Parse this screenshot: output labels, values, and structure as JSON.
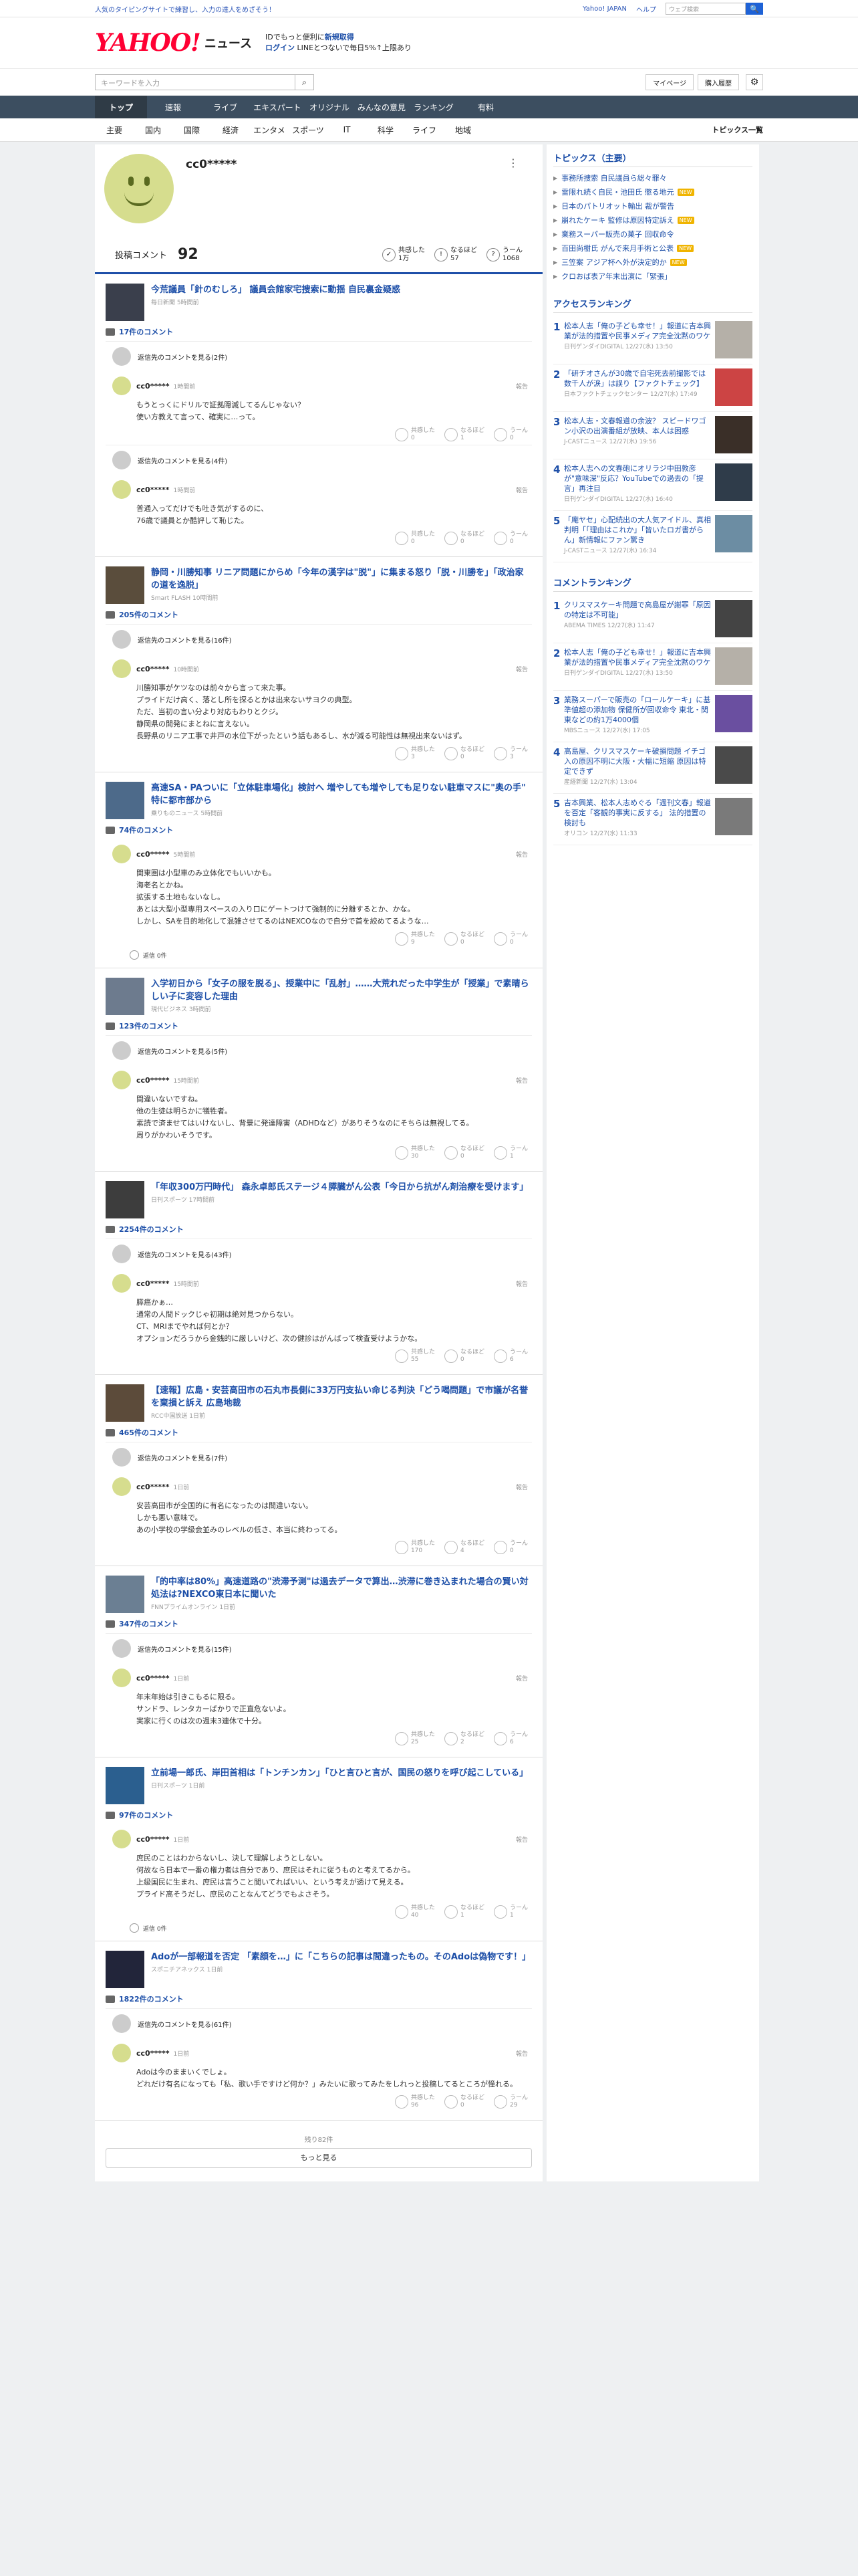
{
  "topbar": {
    "promo": "人気のタイピングサイトで練習し、入力の達人をめざそう！",
    "links": [
      "Yahoo! JAPAN",
      "ヘルプ"
    ],
    "search_placeholder": "ウェブ検索",
    "search_button": "🔍"
  },
  "header": {
    "logo": "YAHOO!",
    "logo_sub": "ニュース",
    "login_line1_a": "IDでもっと便利に",
    "login_line1_b": "新規取得",
    "login_line2": "ログイン",
    "login_line3": "LINEとつないで毎日5%↑上限あり"
  },
  "searchbar": {
    "placeholder": "キーワードを入力",
    "mypage": "マイページ",
    "subscribe": "購入履歴"
  },
  "nav": {
    "main": [
      "トップ",
      "速報",
      "ライブ",
      "エキスパート",
      "オリジナル",
      "みんなの意見",
      "ランキング",
      "有料"
    ],
    "active": "トップ",
    "sub": [
      "主要",
      "国内",
      "国際",
      "経済",
      "エンタメ",
      "スポーツ",
      "IT",
      "科学",
      "ライフ",
      "地域"
    ],
    "topics_link": "トピックス一覧"
  },
  "profile": {
    "name": "cc0*****",
    "comment_label": "投稿コメント",
    "comment_count": "92",
    "stats": [
      {
        "label": "共感した",
        "value": "1万"
      },
      {
        "label": "なるほど",
        "value": "57"
      },
      {
        "label": "うーん",
        "value": "1068"
      }
    ]
  },
  "reactions_labels": {
    "agree": "共感した",
    "naruhodo": "なるほど",
    "un": "うーん"
  },
  "articles": [
    {
      "title": "今荒議員「針のむしろ」 議員会館家宅捜索に動揺 自民裏金疑惑",
      "source": "毎日新聞 5時間前",
      "count": "17件のコメント",
      "thumb": "#3a3f4c",
      "blocks": [
        {
          "type": "replies",
          "text": "返信先のコメントを見る(2件)"
        },
        {
          "type": "comment",
          "user": "cc0*****",
          "time": "1時間前",
          "report": "報告",
          "body": "もうとっくにドリルで証拠隠滅してるんじゃない？\n使い方教えて言って、確実に…って。",
          "r": [
            "0",
            "1",
            "0"
          ]
        },
        {
          "type": "replies",
          "text": "返信先のコメントを見る(4件)"
        },
        {
          "type": "comment",
          "user": "cc0*****",
          "time": "1時間前",
          "report": "報告",
          "body": "普通入ってだけでも吐き気がするのに、\n76歳で議員とか酷評して恥じた。",
          "r": [
            "0",
            "0",
            "0"
          ]
        }
      ]
    },
    {
      "title": "静岡・川勝知事 リニア問題にからめ「今年の漢字は\"脱\"」に集まる怒り「脱・川勝を」「政治家の道を逸脱」",
      "source": "Smart FLASH 10時間前",
      "count": "205件のコメント",
      "thumb": "#5a4d3c",
      "blocks": [
        {
          "type": "replies",
          "text": "返信先のコメントを見る(16件)"
        },
        {
          "type": "comment",
          "user": "cc0*****",
          "time": "10時間前",
          "report": "報告",
          "body": "川勝知事がケツなのは前々から言って来た事。\nプライドだけ高く、落とし所を探るとかは出来ないサヨクの典型。\nただ、当初の言い分より対応もわりとクジ。\n静岡県の開発にまとねに言えない。\n長野県のリニア工事で井戸の水位下がったという話もあるし、水が減る可能性は無視出来ないはず。",
          "r": [
            "3",
            "0",
            "3"
          ]
        }
      ]
    },
    {
      "title": "高速SA・PAついに「立体駐車場化」検討へ 増やしても増やしても足りない駐車マスに\"奥の手\" 特に都市部から",
      "source": "乗りものニュース 5時間前",
      "count": "74件のコメント",
      "thumb": "#4d6a8a",
      "blocks": [
        {
          "type": "comment",
          "user": "cc0*****",
          "time": "5時間前",
          "report": "報告",
          "body": "関東圏は小型車のみ立体化でもいいかも。\n海老名とかね。\n拡張する土地もないなし。\nあとは大型小型専用スペースの入り口にゲートつけて強制的に分離するとか、かな。\nしかし、SAを目的地化して混雑させてるのはNEXCOなので自分で首を絞めてるような…",
          "r": [
            "9",
            "0",
            "0"
          ]
        },
        {
          "type": "retweet",
          "text": "返信 0件"
        }
      ]
    },
    {
      "title": "入学初日から「女子の服を脱る」、授業中に「乱射」……大荒れだった中学生が「授業」で素晴らしい子に変容した理由",
      "source": "現代ビジネス 3時間前",
      "count": "123件のコメント",
      "thumb": "#6d7b8e",
      "blocks": [
        {
          "type": "replies",
          "text": "返信先のコメントを見る(5件)"
        },
        {
          "type": "comment",
          "user": "cc0*****",
          "time": "15時間前",
          "report": "報告",
          "body": "間違いないですね。\n他の生徒は明らかに犠牲者。\n素読で済ませてはいけないし、背景に発達障害（ADHDなど）がありそうなのにそちらは無視してる。\n周りがかわいそうです。",
          "r": [
            "30",
            "0",
            "1"
          ]
        }
      ]
    },
    {
      "title": "「年収300万円時代」 森永卓郎氏ステージ４膵臓がん公表「今日から抗がん剤治療を受けます」",
      "source": "日刊スポーツ 17時間前",
      "count": "2254件のコメント",
      "thumb": "#3d3d3d",
      "blocks": [
        {
          "type": "replies",
          "text": "返信先のコメントを見る(43件)"
        },
        {
          "type": "comment",
          "user": "cc0*****",
          "time": "15時間前",
          "report": "報告",
          "body": "膵癌かぁ…\n通常の人間ドックじゃ初期は絶対見つからない。\nCT、MRIまでやれば何とか？\nオプションだろうから金銭的に厳しいけど、次の健診はがんばって検査受けようかな。",
          "r": [
            "55",
            "0",
            "6"
          ]
        }
      ]
    },
    {
      "title": "【速報】広島・安芸高田市の石丸市長側に33万円支払い命じる判決「どう喝問題」で市議が名誉を棄損と訴え 広島地裁",
      "source": "RCC中国放送 1日前",
      "count": "465件のコメント",
      "thumb": "#5c4b3a",
      "blocks": [
        {
          "type": "replies",
          "text": "返信先のコメントを見る(7件)"
        },
        {
          "type": "comment",
          "user": "cc0*****",
          "time": "1日前",
          "report": "報告",
          "body": "安芸高田市が全国的に有名になったのは間違いない。\nしかも悪い意味で。\nあの小学校の学級会並みのレベルの低さ、本当に終わってる。",
          "r": [
            "170",
            "4",
            "0"
          ]
        }
      ]
    },
    {
      "title": "「的中率は80%」高速道路の\"渋滞予測\"は過去データで算出…渋滞に巻き込まれた場合の賢い対処法は?NEXCO東日本に聞いた",
      "source": "FNNプライムオンライン 1日前",
      "count": "347件のコメント",
      "thumb": "#6b7f93",
      "blocks": [
        {
          "type": "replies",
          "text": "返信先のコメントを見る(15件)"
        },
        {
          "type": "comment",
          "user": "cc0*****",
          "time": "1日前",
          "report": "報告",
          "body": "年末年始は引きこもるに限る。\nサンドラ、レンタカーばかりで正直危ないよ。\n実家に行くのは次の週末3連休で十分。",
          "r": [
            "25",
            "2",
            "6"
          ]
        }
      ]
    },
    {
      "title": "立前場一郎氏、岸田首相は「トンチンカン」「ひと言ひと言が、国民の怒りを呼び起こしている」",
      "source": "日刊スポーツ 1日前",
      "count": "97件のコメント",
      "thumb": "#2b5f8f",
      "blocks": [
        {
          "type": "comment",
          "user": "cc0*****",
          "time": "1日前",
          "report": "報告",
          "body": "庶民のことはわからないし、決して理解しようとしない。\n何故なら日本で一番の権力者は自分であり、庶民はそれに従うものと考えてるから。\n上級国民に生まれ、庶民は言うこと聞いてればいい、という考えが透けて見える。\nプライド高そうだし、庶民のことなんてどうでもよさそう。",
          "r": [
            "40",
            "1",
            "1"
          ]
        },
        {
          "type": "retweet",
          "text": "返信 0件"
        }
      ]
    },
    {
      "title": "Adoが一部報道を否定 「素顔を…」に「こちらの記事は間違ったもの。そのAdoは偽物です！」",
      "source": "スポニチアネックス 1日前",
      "count": "1822件のコメント",
      "thumb": "#22253a",
      "blocks": [
        {
          "type": "replies",
          "text": "返信先のコメントを見る(61件)"
        },
        {
          "type": "comment",
          "user": "cc0*****",
          "time": "1日前",
          "report": "報告",
          "body": "Adoは今のままいくでしょ。\nどれだけ有名になっても「私、歌い手ですけど何か？」みたいに歌ってみたをしれっと投稿してるところが憧れる。",
          "r": [
            "96",
            "0",
            "29"
          ]
        }
      ]
    }
  ],
  "remaining": "残り82件",
  "more_button": "もっと見る",
  "sidebar": {
    "topics_title": "トピックス（主要）",
    "topics": [
      {
        "text": "事務所捜索 自民議員ら総々罪々",
        "new": false
      },
      {
        "text": "雷限れ続く自民・池田氏 懲る地元",
        "new": true
      },
      {
        "text": "日本のパトリオット輸出 裁が警告",
        "new": false
      },
      {
        "text": "崩れたケーキ 監修は原因特定訴え",
        "new": true
      },
      {
        "text": "業務スーパー販売の菓子 回収命令",
        "new": false
      },
      {
        "text": "百田尚樹氏 がんで来月手術と公表",
        "new": true
      },
      {
        "text": "三笠案 アジア杯へ外が決定的か",
        "new": true
      },
      {
        "text": "クロおば表ア年末出演に「緊張」",
        "new": false
      }
    ],
    "access_title": "アクセスランキング",
    "access": [
      {
        "text": "松本人志「俺の子ども幸せ！」報道に吉本興業が法的措置や民事メディア完全沈黙のワケ",
        "src": "日刊ゲンダイDIGITAL 12/27(水) 13:50",
        "img": "#b5b0a8"
      },
      {
        "text": "「研チオさんが30歳で自宅死去前撮影では数千人が涙」は誤り【ファクトチェック】",
        "src": "日本ファクトチェックセンター 12/27(水) 17:49",
        "img": "#c44"
      },
      {
        "text": "松本人志・文春報道の余波？ スピードワゴン小沢の出演番組が放映、本人は困惑",
        "src": "J-CASTニュース 12/27(水) 19:56",
        "img": "#3a2f28"
      },
      {
        "text": "松本人志への文春砲にオリラジ中田敦彦が\"意味深\"反応？YouTubeでの過去の「提言」再注目",
        "src": "日刊ゲンダイDIGITAL 12/27(水) 16:40",
        "img": "#2f3c4a"
      },
      {
        "text": "「庵ヤセ」心配続出の大人気アイドル、真相判明「「理由はこれか」「皆いたロガ書がらん」新情報にファン驚き",
        "src": "J-CASTニュース 12/27(水) 16:34",
        "img": "#6c8da3"
      }
    ],
    "comment_title": "コメントランキング",
    "comments": [
      {
        "text": "クリスマスケーキ問題で高島屋が謝罪「原因の特定は不可能」",
        "src": "ABEMA TIMES 12/27(水) 11:47",
        "img": "#444"
      },
      {
        "text": "松本人志「俺の子ども幸せ！」報道に吉本興業が法的措置や民事メディア完全沈黙のワケ",
        "src": "日刊ゲンダイDIGITAL 12/27(水) 13:50",
        "img": "#b5b0a8"
      },
      {
        "text": "業務スーパーで販売の「ロールケーキ」に基準値超の添加物 保健所が回収命令 東北・関東などの約1万4000個",
        "src": "MBSニュース 12/27(水) 17:05",
        "img": "#6a4fa0"
      },
      {
        "text": "高島屋、クリスマスケーキ破損問題 イチゴ入の原因不明に大阪・大幅に短縮 原因は特定できず",
        "src": "産経新聞 12/27(水) 13:04",
        "img": "#4a4a4a"
      },
      {
        "text": "吉本興業、松本人志めぐる「週刊文春」報道を否定「客観的事実に反する」 法的措置の検討も",
        "src": "オリコン 12/27(水) 11:33",
        "img": "#7a7a7a"
      }
    ]
  }
}
